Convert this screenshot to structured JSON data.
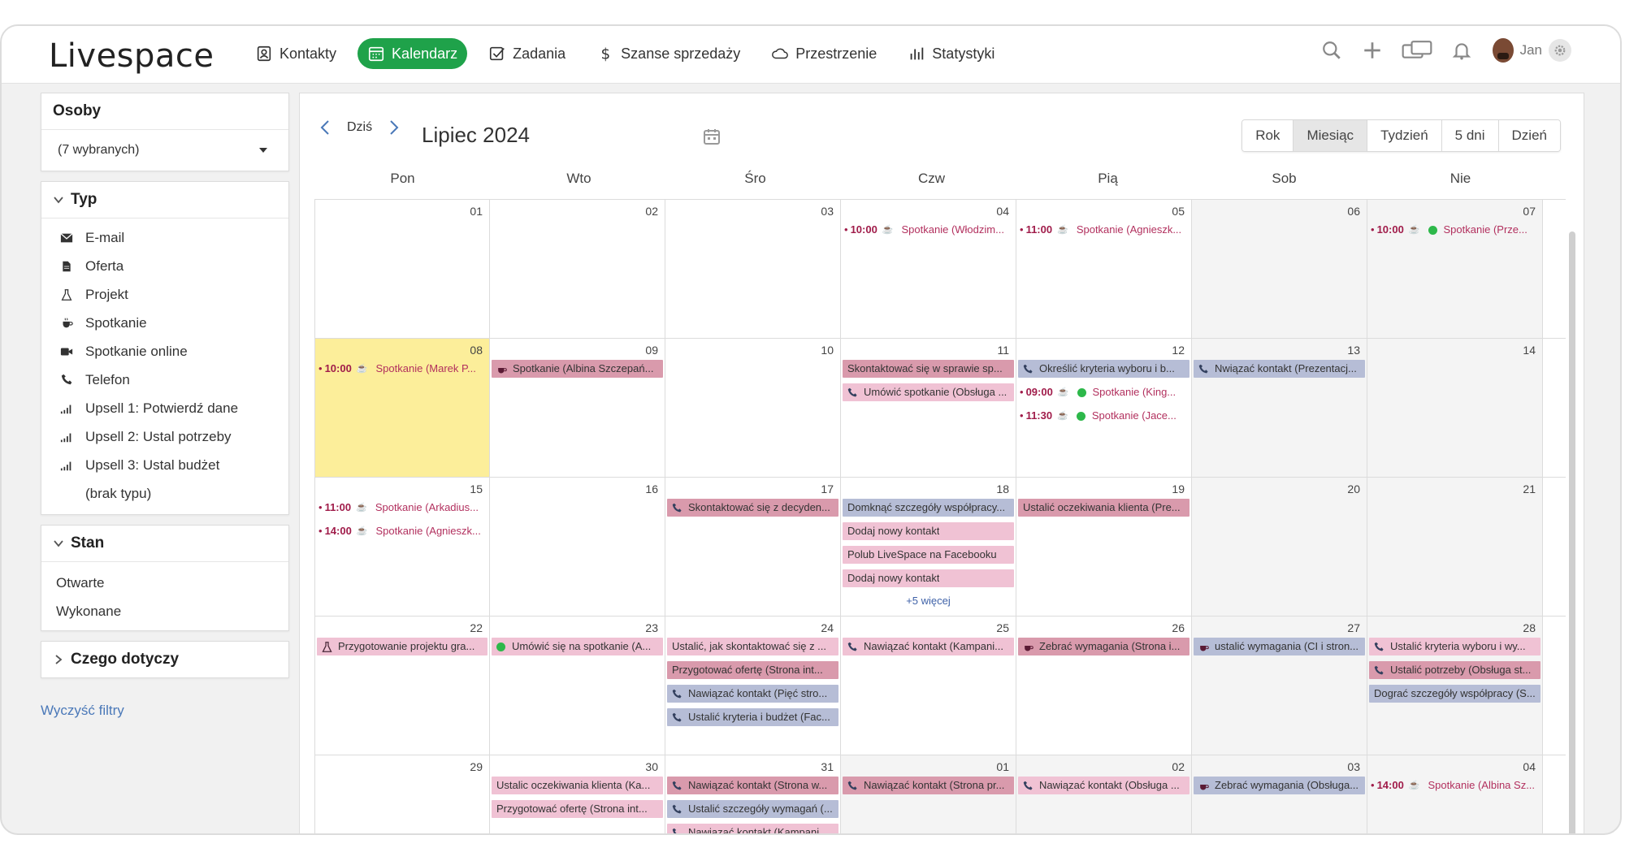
{
  "brand": "Livespace",
  "nav": [
    {
      "label": "Kontakty",
      "icon": "contacts-icon"
    },
    {
      "label": "Kalendarz",
      "icon": "calendar-icon",
      "active": true
    },
    {
      "label": "Zadania",
      "icon": "tasks-icon"
    },
    {
      "label": "Szanse sprzedaży",
      "icon": "dollar-icon"
    },
    {
      "label": "Przestrzenie",
      "icon": "cloud-icon"
    },
    {
      "label": "Statystyki",
      "icon": "stats-icon"
    }
  ],
  "user": {
    "name": "Jan"
  },
  "sidebar": {
    "osoby_title": "Osoby",
    "osoby_value": "(7 wybranych)",
    "typ_title": "Typ",
    "types": [
      {
        "label": "E-mail",
        "icon": "envelope-icon"
      },
      {
        "label": "Oferta",
        "icon": "document-icon"
      },
      {
        "label": "Projekt",
        "icon": "flask-icon"
      },
      {
        "label": "Spotkanie",
        "icon": "coffee-icon"
      },
      {
        "label": "Spotkanie online",
        "icon": "video-icon"
      },
      {
        "label": "Telefon",
        "icon": "phone-icon"
      },
      {
        "label": "Upsell 1: Potwierdź dane",
        "icon": "signal-icon"
      },
      {
        "label": "Upsell 2: Ustal potrzeby",
        "icon": "signal-icon"
      },
      {
        "label": "Upsell 3: Ustal budżet",
        "icon": "signal-icon"
      },
      {
        "label": "(brak typu)",
        "icon": ""
      }
    ],
    "stan_title": "Stan",
    "states": [
      "Otwarte",
      "Wykonane"
    ],
    "czego_title": "Czego dotyczy",
    "clear_filters": "Wyczyść filtry"
  },
  "calendar": {
    "today_label": "Dziś",
    "title": "Lipiec 2024",
    "views": [
      "Rok",
      "Miesiąc",
      "Tydzień",
      "5 dni",
      "Dzień"
    ],
    "active_view": "Miesiąc",
    "weekdays": [
      "Pon",
      "Wto",
      "Śro",
      "Czw",
      "Pią",
      "Sob",
      "Nie"
    ],
    "weeks": [
      [
        {
          "num": "01",
          "events": []
        },
        {
          "num": "02",
          "events": []
        },
        {
          "num": "03",
          "events": []
        },
        {
          "num": "04",
          "events": [
            {
              "kind": "timed",
              "time": "10:00",
              "text": "Spotkanie (Włodzim..."
            }
          ]
        },
        {
          "num": "05",
          "events": [
            {
              "kind": "timed",
              "time": "11:00",
              "text": "Spotkanie (Agnieszk..."
            }
          ]
        },
        {
          "num": "06",
          "weekend": true,
          "events": []
        },
        {
          "num": "07",
          "weekend": true,
          "events": [
            {
              "kind": "timed",
              "time": "10:00",
              "check": true,
              "text": "Spotkanie (Prze..."
            }
          ]
        }
      ],
      [
        {
          "num": "08",
          "today": true,
          "events": [
            {
              "kind": "timed",
              "time": "10:00",
              "text": "Spotkanie (Marek P..."
            }
          ]
        },
        {
          "num": "09",
          "events": [
            {
              "kind": "rose",
              "icon": "coffee",
              "text": "Spotkanie (Albina Szczepań..."
            }
          ]
        },
        {
          "num": "10",
          "events": []
        },
        {
          "num": "11",
          "events": [
            {
              "kind": "rose",
              "icon": "",
              "text": "Skontaktować się w sprawie sp..."
            },
            {
              "kind": "pink",
              "icon": "phone",
              "text": "Umówić spotkanie (Obsługa ..."
            }
          ]
        },
        {
          "num": "12",
          "events": [
            {
              "kind": "blue",
              "icon": "phone",
              "text": "Określić kryteria wyboru i b..."
            },
            {
              "kind": "timed",
              "time": "09:00",
              "check": true,
              "text": "Spotkanie (King..."
            },
            {
              "kind": "timed",
              "time": "11:30",
              "check": true,
              "text": "Spotkanie (Jace..."
            }
          ]
        },
        {
          "num": "13",
          "weekend": true,
          "events": [
            {
              "kind": "blue",
              "icon": "phone",
              "text": "Nwiązać kontakt (Prezentacj..."
            }
          ]
        },
        {
          "num": "14",
          "weekend": true,
          "events": []
        }
      ],
      [
        {
          "num": "15",
          "events": [
            {
              "kind": "timed",
              "time": "11:00",
              "text": "Spotkanie (Arkadius..."
            },
            {
              "kind": "timed",
              "time": "14:00",
              "text": "Spotkanie (Agnieszk..."
            }
          ]
        },
        {
          "num": "16",
          "events": []
        },
        {
          "num": "17",
          "events": [
            {
              "kind": "rose",
              "icon": "phone",
              "text": "Skontaktować się z decyden..."
            }
          ]
        },
        {
          "num": "18",
          "events": [
            {
              "kind": "blue",
              "icon": "",
              "text": "Domknąć szczegóły współpracy..."
            },
            {
              "kind": "pink",
              "icon": "",
              "text": "Dodaj nowy kontakt"
            },
            {
              "kind": "pink",
              "icon": "",
              "text": "Polub LiveSpace na Facebooku"
            },
            {
              "kind": "pink",
              "icon": "",
              "text": "Dodaj nowy kontakt"
            }
          ],
          "more": "+5 więcej"
        },
        {
          "num": "19",
          "events": [
            {
              "kind": "rose",
              "icon": "",
              "text": "Ustalić oczekiwania klienta (Pre..."
            }
          ]
        },
        {
          "num": "20",
          "weekend": true,
          "events": []
        },
        {
          "num": "21",
          "weekend": true,
          "events": []
        }
      ],
      [
        {
          "num": "22",
          "events": [
            {
              "kind": "pink",
              "icon": "flask",
              "text": "Przygotowanie projektu gra..."
            }
          ]
        },
        {
          "num": "23",
          "events": [
            {
              "kind": "pink",
              "icon": "check",
              "text": "Umówić się na spotkanie (A..."
            }
          ]
        },
        {
          "num": "24",
          "events": [
            {
              "kind": "pink",
              "icon": "",
              "text": "Ustalić, jak skontaktować się z ..."
            },
            {
              "kind": "rose",
              "icon": "",
              "text": "Przygotować ofertę (Strona int..."
            },
            {
              "kind": "blue",
              "icon": "phone",
              "text": "Nawiązać kontakt (Pięć stro..."
            },
            {
              "kind": "blue",
              "icon": "phone",
              "text": "Ustalić kryteria i budżet (Fac..."
            }
          ]
        },
        {
          "num": "25",
          "events": [
            {
              "kind": "pink",
              "icon": "phone",
              "text": "Nawiązać kontakt (Kampani..."
            }
          ]
        },
        {
          "num": "26",
          "events": [
            {
              "kind": "rose",
              "icon": "coffee",
              "text": "Zebrać wymagania (Strona i..."
            }
          ]
        },
        {
          "num": "27",
          "weekend": true,
          "events": [
            {
              "kind": "blue",
              "icon": "coffee",
              "text": "ustalić wymagania (CI i stron..."
            }
          ]
        },
        {
          "num": "28",
          "weekend": true,
          "events": [
            {
              "kind": "pink",
              "icon": "phone",
              "text": "Ustalić kryteria wyboru i wy..."
            },
            {
              "kind": "rose",
              "icon": "phone",
              "text": "Ustalić potrzeby (Obsługa st..."
            },
            {
              "kind": "blue",
              "icon": "",
              "text": "Dograć szczegóły współpracy (S..."
            }
          ]
        }
      ],
      [
        {
          "num": "29",
          "events": []
        },
        {
          "num": "30",
          "events": [
            {
              "kind": "pink",
              "icon": "",
              "text": "Ustalic oczekiwania klienta (Ka..."
            },
            {
              "kind": "pink",
              "icon": "",
              "text": "Przygotować ofertę (Strona int..."
            }
          ]
        },
        {
          "num": "31",
          "events": [
            {
              "kind": "rose",
              "icon": "phone",
              "text": "Nawiązać kontakt (Strona w..."
            },
            {
              "kind": "blue",
              "icon": "phone",
              "text": "Ustalić szczegóły wymagań (..."
            },
            {
              "kind": "pink",
              "icon": "phone",
              "text": "Nawiązać kontakt (Kampani..."
            }
          ]
        },
        {
          "num": "01",
          "other": true,
          "events": [
            {
              "kind": "rose",
              "icon": "phone",
              "text": "Nawiązać kontakt (Strona pr..."
            }
          ]
        },
        {
          "num": "02",
          "other": true,
          "events": [
            {
              "kind": "pink",
              "icon": "phone",
              "text": "Nawiązać kontakt (Obsługa ..."
            }
          ]
        },
        {
          "num": "03",
          "weekend": true,
          "events": [
            {
              "kind": "blue",
              "icon": "coffee",
              "text": "Zebrać wymagania (Obsługa..."
            }
          ]
        },
        {
          "num": "04",
          "weekend": true,
          "events": [
            {
              "kind": "timed",
              "time": "14:00",
              "text": "Spotkanie (Albina Sz..."
            }
          ]
        }
      ]
    ]
  }
}
